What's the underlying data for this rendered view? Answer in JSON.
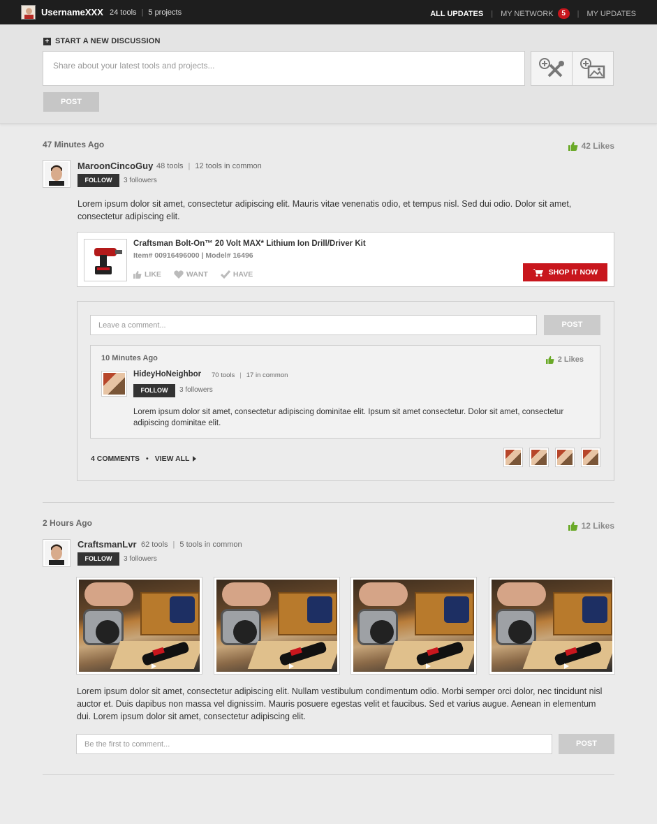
{
  "topbar": {
    "username": "UsernameXXX",
    "tools": "24 tools",
    "projects": "5 projects",
    "nav": {
      "all_updates": "ALL UPDATES",
      "my_network": "MY NETWORK",
      "my_network_count": "5",
      "my_updates": "MY UPDATES"
    }
  },
  "composer": {
    "title": "START A NEW DISCUSSION",
    "placeholder": "Share about your latest tools and projects...",
    "post_label": "POST"
  },
  "posts": [
    {
      "timestamp": "47 Minutes Ago",
      "likes": "42 Likes",
      "user": {
        "name": "MaroonCincoGuy",
        "tools": "48 tools",
        "common": "12 tools in common",
        "follow_label": "FOLLOW",
        "followers": "3 followers"
      },
      "text": "Lorem ipsum dolor sit amet, consectetur adipiscing elit. Mauris vitae venenatis odio, et tempus nisl. Sed dui odio. Dolor sit amet, consectetur adipiscing elit.",
      "product": {
        "title": "Craftsman Bolt-On™ 20 Volt MAX* Lithium Ion Drill/Driver Kit",
        "item_line": "Item#  00916496000 | Model#  16496",
        "like": "LIKE",
        "want": "WANT",
        "have": "HAVE",
        "shop_label": "SHOP IT NOW"
      },
      "comments": {
        "placeholder": "Leave a comment...",
        "post_label": "POST",
        "reply": {
          "timestamp": "10 Minutes Ago",
          "likes": "2 Likes",
          "user": {
            "name": "HideyHoNeighbor",
            "tools": "70 tools",
            "common": "17 in common",
            "follow_label": "FOLLOW",
            "followers": "3 followers"
          },
          "text": "Lorem ipsum dolor sit amet, consectetur adipiscing dominitae elit. Ipsum sit amet consectetur. Dolor sit amet, consectetur adipiscing dominitae elit."
        },
        "count_label": "4 COMMENTS",
        "view_all": "VIEW ALL"
      }
    },
    {
      "timestamp": "2 Hours Ago",
      "likes": "12 Likes",
      "user": {
        "name": "CraftsmanLvr",
        "tools": "62 tools",
        "common": "5 tools in common",
        "follow_label": "FOLLOW",
        "followers": "3 followers"
      },
      "text": "Lorem ipsum dolor sit amet, consectetur adipiscing elit. Nullam vestibulum condimentum odio. Morbi semper orci dolor, nec tincidunt nisl auctor et. Duis dapibus non massa vel dignissim. Mauris posuere egestas velit et faucibus. Sed et varius augue. Aenean in elementum dui. Lorem ipsum dolor sit amet, consectetur adipiscing elit.",
      "comment_placeholder": "Be the first to comment...",
      "post_label": "POST"
    }
  ],
  "colors": {
    "accent_red": "#c8161d",
    "like_green": "#6aa928",
    "topbar": "#1e1e1e"
  }
}
